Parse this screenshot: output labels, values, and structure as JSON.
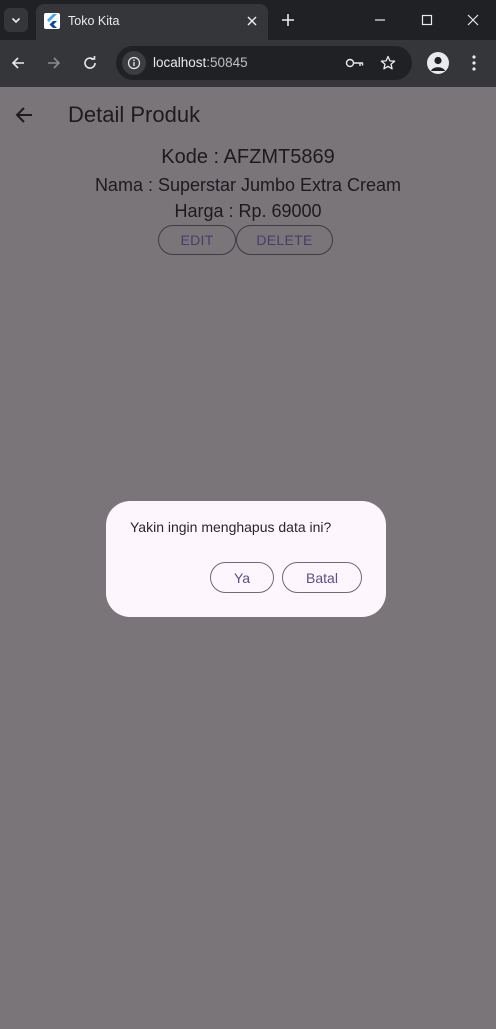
{
  "browser": {
    "tab_title": "Toko Kita",
    "url_host": "localhost",
    "url_port": ":50845"
  },
  "app": {
    "title": "Detail Produk",
    "kode": "Kode : AFZMT5869",
    "nama": "Nama : Superstar Jumbo Extra Cream",
    "harga": "Harga : Rp. 69000",
    "edit_label": "EDIT",
    "delete_label": "DELETE"
  },
  "dialog": {
    "message": "Yakin ingin menghapus data ini?",
    "yes_label": "Ya",
    "cancel_label": "Batal"
  },
  "colors": {
    "scrim": "#7a7579",
    "dialog_bg": "#fdf6fd",
    "button_text": "#5a4f89",
    "chrome_dark": "#202124",
    "chrome_toolbar": "#35363a"
  }
}
